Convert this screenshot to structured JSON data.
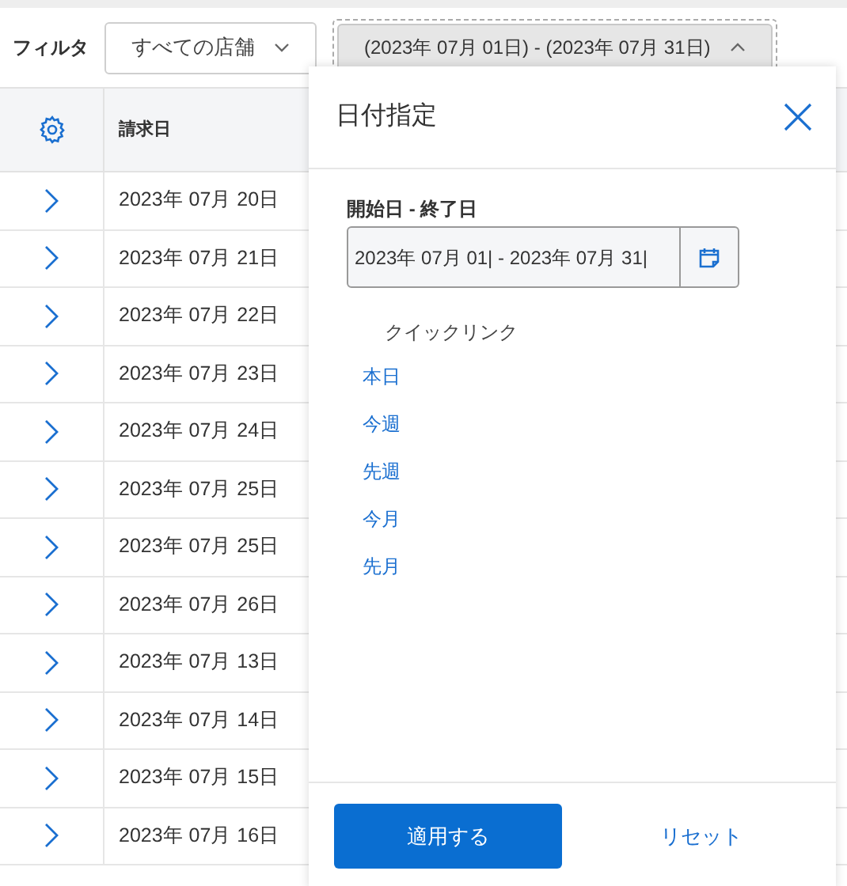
{
  "filter": {
    "label": "フィルタ",
    "store_select": "すべての店舗",
    "date_range_button": "(2023年 07月 01日) - (2023年 07月 31日)",
    "date_range_expanded": true
  },
  "table": {
    "columns": [
      "請求日"
    ],
    "rows": [
      {
        "date": "2023年 07月 20日"
      },
      {
        "date": "2023年 07月 21日"
      },
      {
        "date": "2023年 07月 22日"
      },
      {
        "date": "2023年 07月 23日"
      },
      {
        "date": "2023年 07月 24日"
      },
      {
        "date": "2023年 07月 25日"
      },
      {
        "date": "2023年 07月 25日"
      },
      {
        "date": "2023年 07月 26日"
      },
      {
        "date": "2023年 07月 13日"
      },
      {
        "date": "2023年 07月 14日"
      },
      {
        "date": "2023年 07月 15日"
      },
      {
        "date": "2023年 07月 16日"
      }
    ]
  },
  "date_panel": {
    "title": "日付指定",
    "range_label": "開始日 - 終了日",
    "range_value": "2023年 07月 01| - 2023年 07月 31|",
    "quick_links_title": "クイックリンク",
    "quick_links": [
      "本日",
      "今週",
      "先週",
      "今月",
      "先月"
    ],
    "apply_button": "適用する",
    "reset_button": "リセット"
  }
}
